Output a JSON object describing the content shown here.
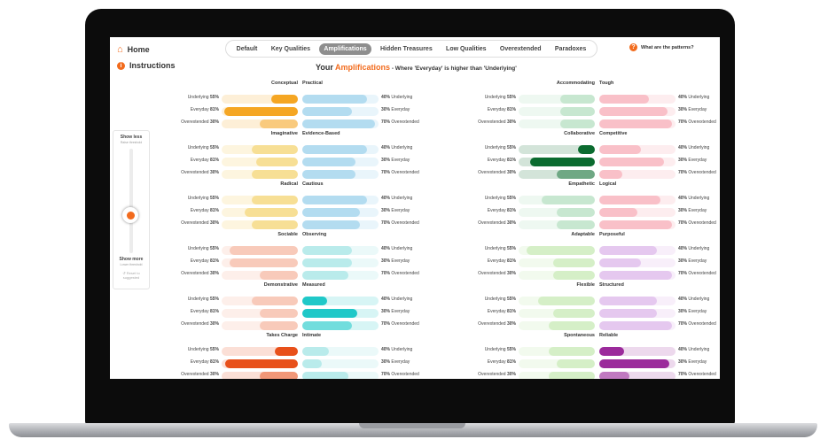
{
  "nav": {
    "home": "Home",
    "instructions": "Instructions"
  },
  "tabs": [
    {
      "label": "Default",
      "active": false
    },
    {
      "label": "Key Qualities",
      "active": false
    },
    {
      "label": "Amplifications",
      "active": true
    },
    {
      "label": "Hidden Treasures",
      "active": false
    },
    {
      "label": "Low Qualities",
      "active": false
    },
    {
      "label": "Overextended",
      "active": false
    },
    {
      "label": "Paradoxes",
      "active": false
    }
  ],
  "help": {
    "label": "What are the patterns?"
  },
  "title": {
    "prefix": "Your",
    "highlight": "Amplifications",
    "suffix": " - Where 'Everyday' is higher than 'Underlying'"
  },
  "slider": {
    "top_label": "Show less",
    "top_sub": "Raise threshold",
    "bottom_label": "Show more",
    "bottom_sub": "Lower threshold",
    "reset": "Reset to suggested"
  },
  "metric_labels": [
    "Underlying",
    "Everyday",
    "Overextended"
  ],
  "left_values": [
    "55%",
    "81%",
    "30%"
  ],
  "right_values": [
    "40%",
    "30%",
    "70%"
  ],
  "groups": [
    {
      "left": "Conceptual",
      "right": "Practical",
      "lcolor": "#f5a623",
      "rcolor": "#86c6e8",
      "left_fill": [
        0.35,
        0.97,
        0.5
      ],
      "right_fill": [
        0.85,
        0.65,
        0.95
      ],
      "strong": "left"
    },
    {
      "left": "Imaginative",
      "right": "Evidence-Based",
      "lcolor": "#f2c94c",
      "rcolor": "#86c6e8",
      "left_fill": [
        0.6,
        0.55,
        0.6
      ],
      "right_fill": [
        0.85,
        0.7,
        0.7
      ],
      "strong": "none"
    },
    {
      "left": "Radical",
      "right": "Cautious",
      "lcolor": "#f2c94c",
      "rcolor": "#86c6e8",
      "left_fill": [
        0.6,
        0.7,
        0.6
      ],
      "right_fill": [
        0.85,
        0.75,
        0.75
      ],
      "strong": "none"
    },
    {
      "left": "Sociable",
      "right": "Observing",
      "lcolor": "#f4a58a",
      "rcolor": "#8fe0e0",
      "left_fill": [
        0.9,
        0.9,
        0.5
      ],
      "right_fill": [
        0.65,
        0.65,
        0.6
      ],
      "strong": "none"
    },
    {
      "left": "Demonstrative",
      "right": "Measured",
      "lcolor": "#f4a58a",
      "rcolor": "#1fc8c8",
      "left_fill": [
        0.6,
        0.5,
        0.5
      ],
      "right_fill": [
        0.32,
        0.72,
        0.65
      ],
      "strong": "right"
    },
    {
      "left": "Takes Charge",
      "right": "Intimate",
      "lcolor": "#e8501a",
      "rcolor": "#8fe0e0",
      "left_fill": [
        0.3,
        0.95,
        0.5
      ],
      "right_fill": [
        0.35,
        0.25,
        0.6
      ],
      "strong": "left"
    },
    {
      "left": "Accommodating",
      "right": "Tough",
      "lcolor": "#9fd6b0",
      "rcolor": "#f59aa8",
      "left_fill": [
        0.45,
        0.45,
        0.45
      ],
      "right_fill": [
        0.65,
        0.9,
        0.95
      ],
      "strong": "none"
    },
    {
      "left": "Collaborative",
      "right": "Competitive",
      "lcolor": "#0b6b2f",
      "rcolor": "#f59aa8",
      "left_fill": [
        0.22,
        0.85,
        0.5
      ],
      "right_fill": [
        0.55,
        0.85,
        0.3
      ],
      "strong": "left"
    },
    {
      "left": "Empathetic",
      "right": "Logical",
      "lcolor": "#9fd6b0",
      "rcolor": "#f59aa8",
      "left_fill": [
        0.7,
        0.5,
        0.5
      ],
      "right_fill": [
        0.8,
        0.5,
        0.95
      ],
      "strong": "none"
    },
    {
      "left": "Adaptable",
      "right": "Purposeful",
      "lcolor": "#b7e4a0",
      "rcolor": "#d6a7e6",
      "left_fill": [
        0.9,
        0.55,
        0.55
      ],
      "right_fill": [
        0.75,
        0.55,
        0.95
      ],
      "strong": "none"
    },
    {
      "left": "Flexible",
      "right": "Structured",
      "lcolor": "#b7e4a0",
      "rcolor": "#d6a7e6",
      "left_fill": [
        0.75,
        0.55,
        0.6
      ],
      "right_fill": [
        0.75,
        0.75,
        0.95
      ],
      "strong": "none"
    },
    {
      "left": "Spontaneous",
      "right": "Reliable",
      "lcolor": "#b7e4a0",
      "rcolor": "#9b2a9b",
      "left_fill": [
        0.6,
        0.5,
        0.6
      ],
      "right_fill": [
        0.33,
        0.92,
        0.4
      ],
      "strong": "right"
    }
  ]
}
